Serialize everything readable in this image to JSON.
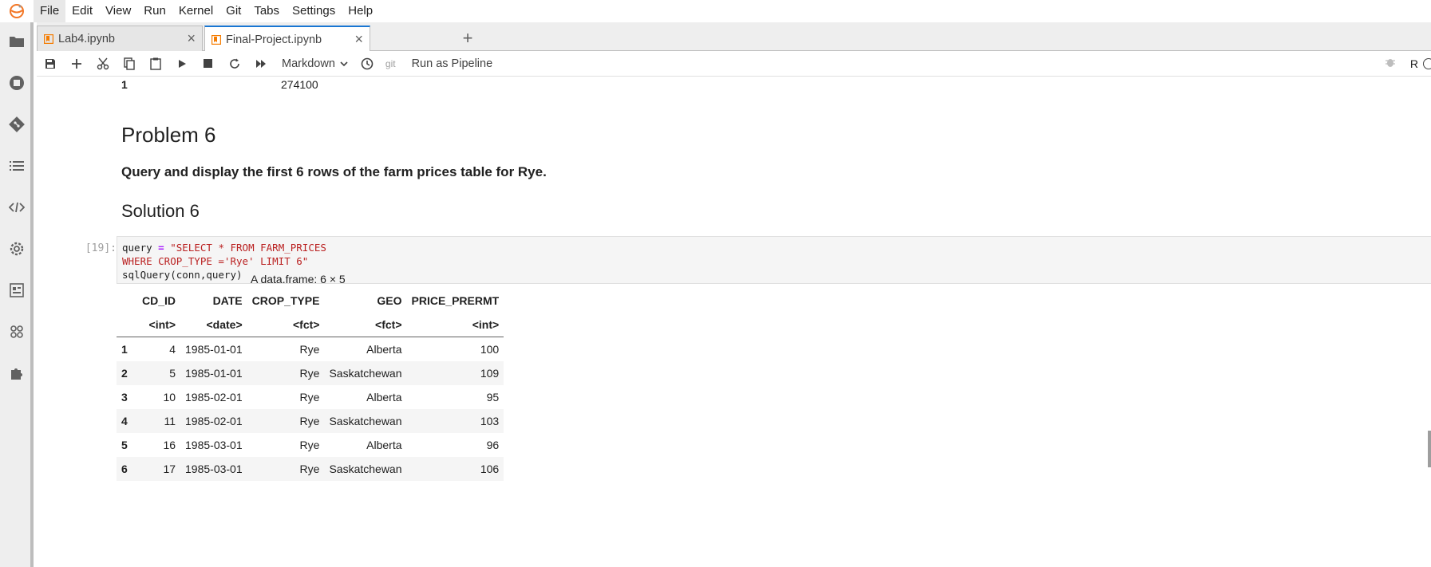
{
  "menu": [
    "File",
    "Edit",
    "View",
    "Run",
    "Kernel",
    "Git",
    "Tabs",
    "Settings",
    "Help"
  ],
  "tabs": [
    {
      "label": "Lab4.ipynb",
      "active": false
    },
    {
      "label": "Final-Project.ipynb",
      "active": true
    }
  ],
  "toolbar": {
    "cell_type": "Markdown",
    "git_label": "git",
    "pipeline_label": "Run as Pipeline",
    "kernel_name": "R"
  },
  "notebook": {
    "prev_output": {
      "index": "1",
      "value": "274100"
    },
    "problem_heading": "Problem 6",
    "problem_text": "Query and display the first 6 rows of the farm prices table for Rye.",
    "solution_heading": "Solution 6",
    "cell_prompt": "[19]:",
    "code": {
      "l1_var": "query",
      "l1_op": "=",
      "l1_str": "\"SELECT * FROM FARM_PRICES",
      "l2_str": "WHERE CROP_TYPE ='Rye' LIMIT 6\"",
      "l3": "sqlQuery(conn,query)"
    },
    "output": {
      "caption": "A data.frame: 6 × 5",
      "columns": [
        "CD_ID",
        "DATE",
        "CROP_TYPE",
        "GEO",
        "PRICE_PRERMT"
      ],
      "types": [
        "<int>",
        "<date>",
        "<fct>",
        "<fct>",
        "<int>"
      ],
      "rows": [
        [
          "1",
          "4",
          "1985-01-01",
          "Rye",
          "Alberta",
          "100"
        ],
        [
          "2",
          "5",
          "1985-01-01",
          "Rye",
          "Saskatchewan",
          "109"
        ],
        [
          "3",
          "10",
          "1985-02-01",
          "Rye",
          "Alberta",
          "95"
        ],
        [
          "4",
          "11",
          "1985-02-01",
          "Rye",
          "Saskatchewan",
          "103"
        ],
        [
          "5",
          "16",
          "1985-03-01",
          "Rye",
          "Alberta",
          "96"
        ],
        [
          "6",
          "17",
          "1985-03-01",
          "Rye",
          "Saskatchewan",
          "106"
        ]
      ]
    }
  },
  "colors": {
    "accent": "#1976d2",
    "notebook_icon": "#f57c00",
    "sidebar_bg": "#eeeeee"
  },
  "icons": {
    "sidebar": [
      "folder-icon",
      "running-icon",
      "git-icon",
      "toc-icon",
      "code-snippet-icon",
      "settings-gear-icon",
      "property-inspector-icon",
      "extension-grid-icon",
      "puzzle-icon"
    ],
    "toolbar": [
      "save-icon",
      "add-icon",
      "cut-icon",
      "copy-icon",
      "paste-icon",
      "run-icon",
      "stop-icon",
      "restart-icon",
      "fast-forward-icon",
      "clock-icon"
    ]
  }
}
